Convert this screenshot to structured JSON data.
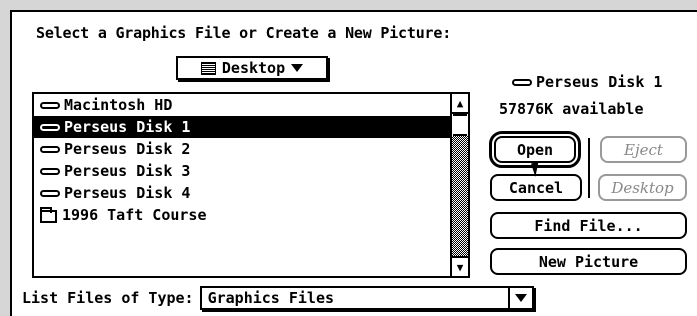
{
  "dialog": {
    "title": "Select a Graphics File or Create a New Picture:",
    "location_popup": {
      "label": "Desktop",
      "icon": "desktop-icon"
    },
    "files": [
      {
        "name": "Macintosh HD",
        "icon": "drive-icon",
        "selected": false
      },
      {
        "name": "Perseus Disk 1",
        "icon": "drive-icon",
        "selected": true
      },
      {
        "name": "Perseus Disk 2",
        "icon": "drive-icon",
        "selected": false
      },
      {
        "name": "Perseus Disk 3",
        "icon": "drive-icon",
        "selected": false
      },
      {
        "name": "Perseus Disk 4",
        "icon": "drive-icon",
        "selected": false
      },
      {
        "name": "1996 Taft Course",
        "icon": "folder-icon",
        "selected": false
      }
    ],
    "volume": {
      "name": "Perseus Disk 1",
      "available": "57876K available"
    },
    "buttons": {
      "open": "Open",
      "eject": "Eject",
      "cancel": "Cancel",
      "desktop": "Desktop",
      "find_file": "Find File...",
      "new_picture": "New Picture"
    },
    "file_types": {
      "label": "List Files of Type:",
      "value": "Graphics Files"
    }
  }
}
